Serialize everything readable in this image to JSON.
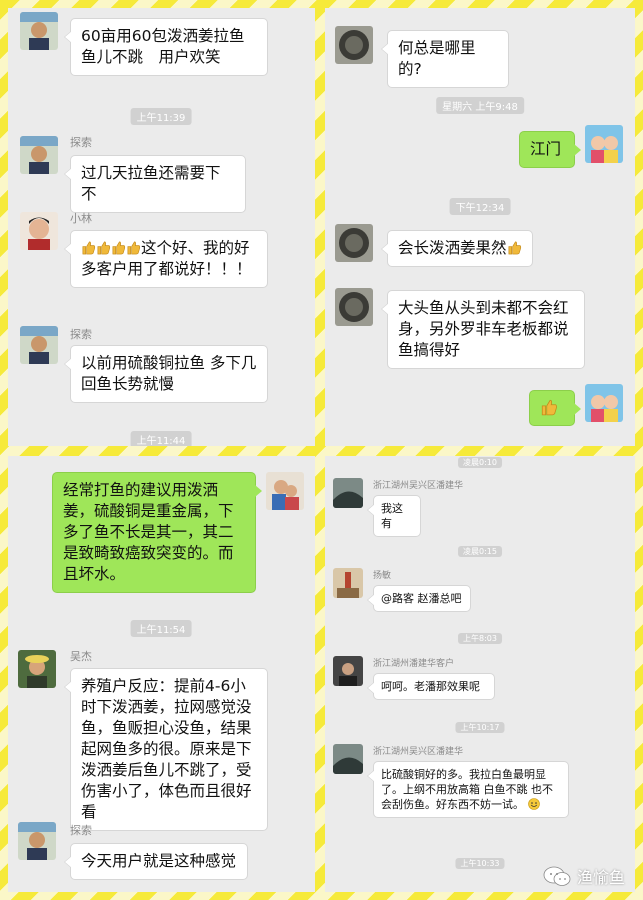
{
  "panel1": {
    "msg1": "60亩用60包泼洒姜拉鱼鱼儿不跳　用户欢笑",
    "time1": "上午11:39",
    "name2": "探索",
    "msg2": "过几天拉鱼还需要下不",
    "name3": "小林",
    "msg3": "这个好、我的好多客户用了都说好！！！",
    "name4": "探索",
    "msg4": "以前用硫酸铜拉鱼 多下几回鱼长势就慢",
    "time2": "上午11:44"
  },
  "panel2": {
    "msg1": "何总是哪里的?",
    "time1": "星期六 上午9:48",
    "msg2": "江门",
    "time2": "下午12:34",
    "msg3": "会长泼洒姜果然",
    "msg4": "大头鱼从头到未都不会红身，另外罗非车老板都说鱼搞得好"
  },
  "panel3": {
    "msg1": "经常打鱼的建议用泼洒姜，硫酸铜是重金属，下多了鱼不长是其一，其二是致畸致癌致突变的。而且坏水。",
    "time1": "上午11:54",
    "name2": "吴杰",
    "msg2": "养殖户反应：提前4-6小时下泼洒姜，拉网感觉没鱼，鱼贩担心没鱼，结果起网鱼多的很。原来是下泼洒姜后鱼儿不跳了，受伤害小了，体色而且很好看",
    "name3": "探索",
    "msg3": "今天用户就是这种感觉"
  },
  "panel4": {
    "time0": "凌晨0:10",
    "name1": "浙江湖州吴兴区潘建华",
    "msg1": "我这有",
    "time1": "凌晨0:15",
    "name2": "扬敏",
    "msg2": "@路客 赵潘总吧",
    "time2": "上午8:03",
    "name3": "浙江湖州潘建华客户",
    "msg3": "呵呵。老潘那效果呢",
    "time3": "上午10:17",
    "name4": "浙江湖州吴兴区潘建华",
    "msg4": "比硫酸铜好的多。我拉白鱼最明显了。上纲不用放高箱 白鱼不跳 也不会刮伤鱼。好东西不妨一试。",
    "time4": "上午10:33"
  },
  "watermark": "渔愉鱼",
  "icons": [
    "thumbs-up-icon",
    "smile-emoji-icon",
    "watermark-logo-icon"
  ],
  "colors": {
    "sent_bubble": "#9fe659",
    "chat_bg": "#ebebeb",
    "frame_yellow": "#f6ea3a"
  }
}
